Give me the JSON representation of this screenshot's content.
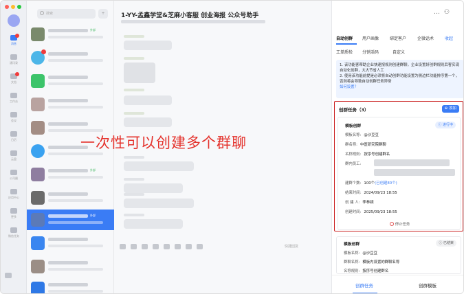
{
  "rail": {
    "items": [
      "消息",
      "通讯录",
      "文档",
      "工作台",
      "会议",
      "日历",
      "云盘",
      "公司圈",
      "应用中心",
      "更多",
      "微信任务"
    ]
  },
  "list": {
    "search_placeholder": "搜索",
    "items": [
      {
        "tag": "外部"
      },
      {
        "tag": ""
      },
      {
        "tag": ""
      },
      {
        "tag": ""
      },
      {
        "tag": ""
      },
      {
        "tag": ""
      },
      {
        "tag": "外部"
      },
      {
        "tag": ""
      },
      {
        "tag": "外部"
      },
      {
        "tag": ""
      },
      {
        "tag": ""
      },
      {
        "tag": ""
      }
    ]
  },
  "chat": {
    "title": "1-YY-孟鑫学堂&芝麻小客服 创业海报 公众号助手",
    "quick_reply": "快捷回复"
  },
  "right": {
    "tabs": [
      "自动创群",
      "用户画像",
      "绑定客户",
      "企微话术",
      "收起",
      "工单质检",
      "分销活码",
      "自定义"
    ],
    "note_1": "1. 该功能客帮助企业快速按规则创建群聊，企业设置好创群规则后客实现自动化创群，大大节省人工",
    "note_2": "2. 使用该功能前提是必须将自动创群功能设置为侧边栏功能排序第一个，否则将会导致自动创群任务异常",
    "note_link": "如何设置？",
    "card_title": "创群任务（3）",
    "add_label": "添加",
    "task_name": "模板创群",
    "status": "进行中",
    "rows": [
      {
        "k": "模板名称:",
        "v": "@沙豆豆"
      },
      {
        "k": "群名称:",
        "v": "中医研究院群聊"
      },
      {
        "k": "名称规则:",
        "v": "按序号创建群名"
      },
      {
        "k": "群内员工:",
        "v": ""
      },
      {
        "k": "建群个数:",
        "v": "100个",
        "extra": "(已创建80个)"
      },
      {
        "k": "结束时间:",
        "v": "2024/09/23  18:55"
      },
      {
        "k": "创 建 人:",
        "v": "李林颖"
      },
      {
        "k": "创建时间:",
        "v": "2025/09/23  18:55"
      }
    ],
    "stop": "停止任务",
    "task2": {
      "name": "模板创群",
      "status": "已结束",
      "rows": [
        {
          "k": "模板名称:",
          "v": "@沙豆豆"
        },
        {
          "k": "群聊名称:",
          "v": "模板内设置的群聊名称"
        },
        {
          "k": "名称规则:",
          "v": "按序号创建群名"
        }
      ]
    },
    "bottom_tabs": [
      "创群任务",
      "创群模板"
    ]
  },
  "overlay_text": "一次性可以创建多个群聊",
  "colors": {
    "accent": "#3a7cf5",
    "highlight": "#cc2424",
    "overlay": "#e4312b"
  }
}
